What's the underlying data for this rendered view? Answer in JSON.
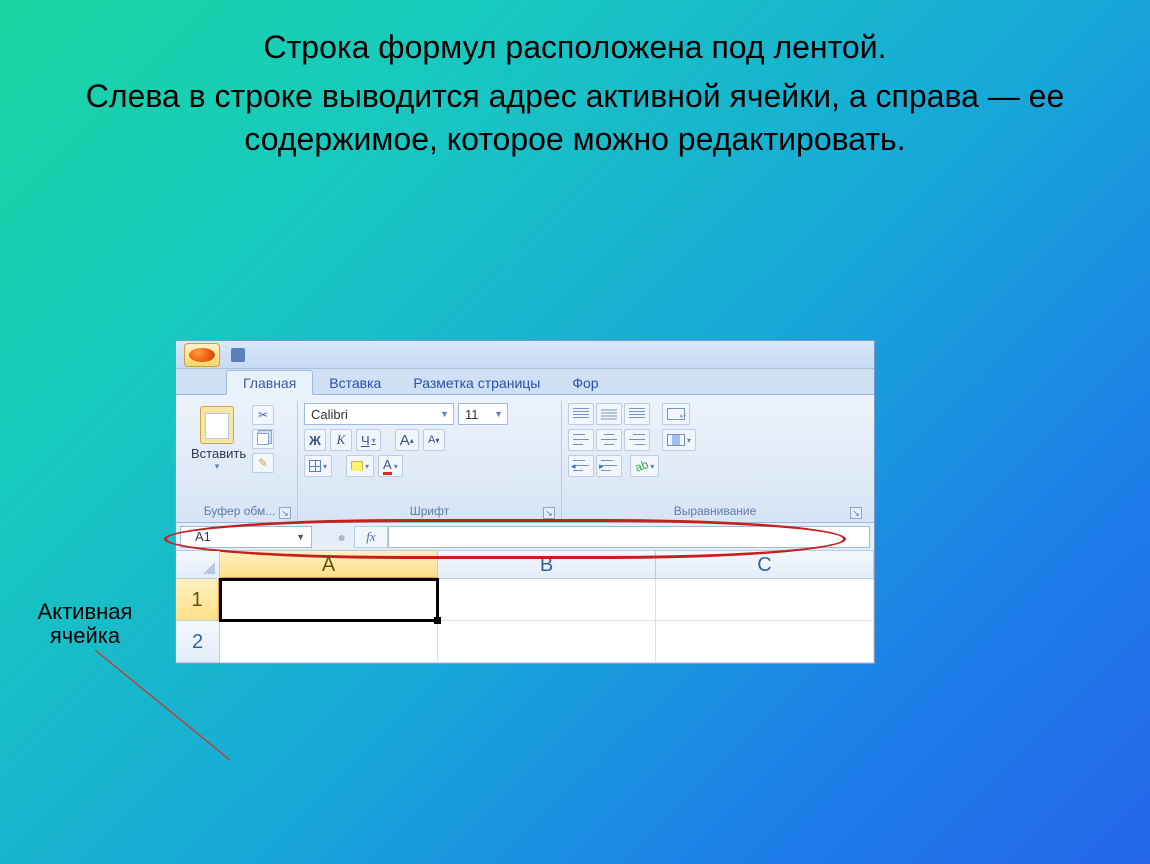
{
  "slide": {
    "line1": "Строка формул расположена под лентой.",
    "line2": "Слева в строке выводится адрес активной ячейки, а справа — ее содержимое, которое можно редактировать."
  },
  "callout": {
    "text": "Активная ячейка"
  },
  "ribbon": {
    "tabs": {
      "home": "Главная",
      "insert": "Вставка",
      "layout": "Разметка страницы",
      "formulas_partial": "Фор"
    },
    "clipboard": {
      "paste": "Вставить",
      "group_label": "Буфер обм..."
    },
    "font": {
      "name": "Calibri",
      "size": "11",
      "bold": "Ж",
      "italic": "К",
      "underline": "Ч",
      "grow": "A",
      "shrink": "A",
      "font_color": "A",
      "group_label": "Шрифт"
    },
    "alignment": {
      "group_label": "Выравнивание"
    }
  },
  "formula_bar": {
    "name_box": "A1",
    "fx": "fx"
  },
  "sheet": {
    "columns": [
      "A",
      "B",
      "C"
    ],
    "rows": [
      "1",
      "2"
    ]
  }
}
